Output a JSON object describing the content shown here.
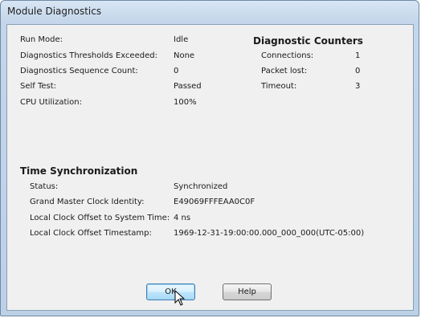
{
  "window": {
    "title": "Module Diagnostics"
  },
  "general": {
    "run_mode_label": "Run Mode:",
    "run_mode_value": "Idle",
    "thresholds_label": "Diagnostics Thresholds Exceeded:",
    "thresholds_value": "None",
    "sequence_label": "Diagnostics Sequence Count:",
    "sequence_value": "0",
    "self_test_label": "Self Test:",
    "self_test_value": "Passed",
    "cpu_label": "CPU Utilization:",
    "cpu_value": "100%"
  },
  "counters": {
    "heading": "Diagnostic Counters",
    "connections_label": "Connections:",
    "connections_value": "1",
    "packet_lost_label": "Packet lost:",
    "packet_lost_value": "0",
    "timeout_label": "Timeout:",
    "timeout_value": "3"
  },
  "time_sync": {
    "heading": "Time Synchronization",
    "status_label": "Status:",
    "status_value": "Synchronized",
    "gm_label": "Grand Master Clock Identity:",
    "gm_value": "E49069FFFEAA0C0F",
    "offset_label": "Local Clock Offset to System Time:",
    "offset_value": "4 ns",
    "timestamp_label": "Local Clock Offset Timestamp:",
    "timestamp_value": "1969-12-31-19:00:00.000_000_000(UTC-05:00)"
  },
  "buttons": {
    "ok_label": "OK",
    "help_label": "Help"
  },
  "icons": {
    "cursor": "mouse-pointer-icon"
  }
}
